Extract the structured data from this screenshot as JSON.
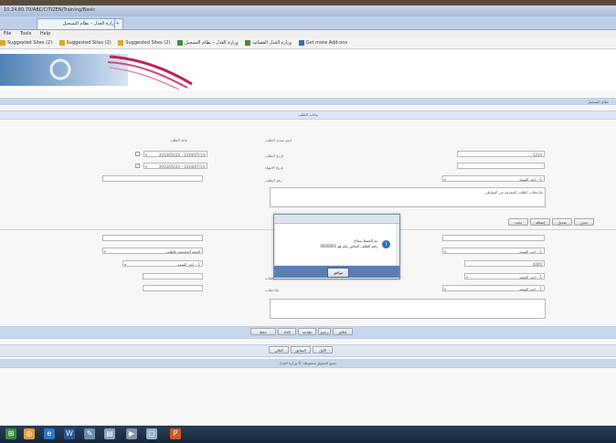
{
  "browser": {
    "url": "10.24.80.70/ABC/CITIZEN/Training/Basic",
    "tab_label": "وزارة العدل - نظام التسجيل",
    "menu": [
      "File",
      "Tools",
      "Help"
    ],
    "favorites": [
      "Suggested Sites (2)",
      "Suggested Sites (2)",
      "Suggested Sites (2)",
      "وزارة العدل - نظام التسجيل",
      "وزارة العدل القضائية",
      "Get more Add-ons"
    ]
  },
  "page": {
    "section_strip_label": "نظام التسجيل",
    "subtitle_strip_label": "بيانات الطلب",
    "form_top": {
      "label_request_date": "تاريخ الطلب",
      "label_request_number": "رقم الطلب",
      "label_status": "حالة الطلب",
      "label_applicant": "اسم مقدم الطلب",
      "label_date_from": "تاريخ البدء",
      "label_date_to": "تاريخ الانتهاء",
      "request_number_value": "1234",
      "field_select_value": "1 - اختر القيمة",
      "date_from_value": "1434/07/14 - 2013/05/24",
      "date_to_value": "1434/07/14 - 2013/05/24",
      "notes_value": "ملاحظات الطلب المقدمة من المواطن"
    },
    "toolbar_buttons": [
      "بحث",
      "إضافة",
      "تعديل",
      "حذف"
    ],
    "form_bottom": {
      "select_1": "1 - اختر القيمة",
      "select_2": "الجهة المختصة بالطلب",
      "select_3": "1 - اختر القيمة",
      "input_1": "4000",
      "label_1": "المرفقات",
      "label_2": "ملاحظات"
    },
    "action_buttons_row1": [
      "حفظ",
      "إلغاء",
      "طباعة",
      "رجوع",
      "إغلاق"
    ],
    "action_buttons_row2": [
      "التالي",
      "السابق",
      "الأول"
    ],
    "footer_text": "جميع الحقوق محفوظة © وزارة العدل"
  },
  "dialog": {
    "message_line1": "تم الحفظ بنجاح",
    "message_line2": "رقم الطلب الخاص بكم هو 0000001",
    "ok_label": "موافق",
    "icon": "info-icon"
  },
  "taskbar": {
    "icons": [
      "start-icon",
      "chrome-icon",
      "ie-icon",
      "word-icon",
      "paint-icon",
      "explorer-icon",
      "media-icon",
      "powerpoint-icon"
    ]
  }
}
